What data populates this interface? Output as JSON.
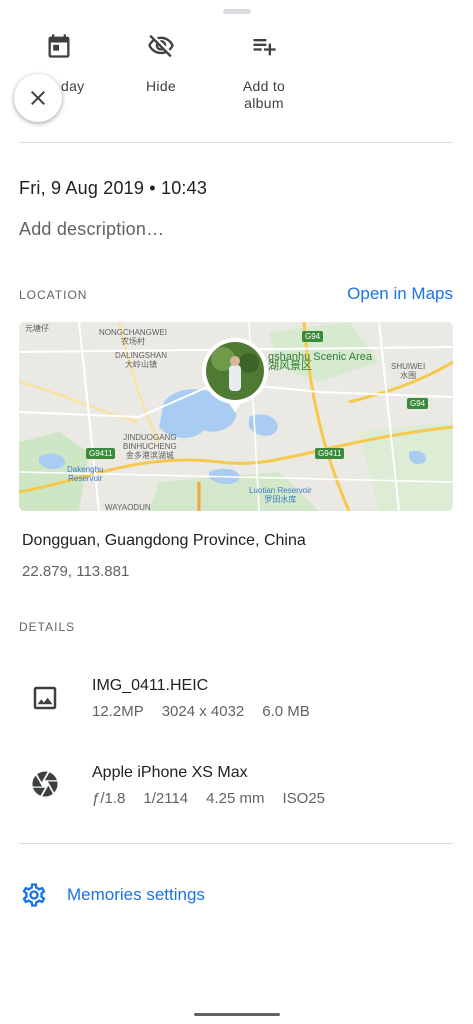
{
  "actions": {
    "day_label": "day",
    "hide_label": "Hide",
    "album_label_line1": "Add to",
    "album_label_line2": "album"
  },
  "info": {
    "datetime": "Fri, 9 Aug 2019  •  10:43",
    "description_placeholder": "Add description…"
  },
  "location": {
    "section_title": "LOCATION",
    "open_in_maps": "Open in Maps",
    "place": "Dongguan, Guangdong Province, China",
    "coordinates": "22.879, 113.881",
    "map_labels": {
      "nongchangwei": "NONGCHANGWEI",
      "nongchangwei_cn": "农场村",
      "dalingshan": "DALINGSHAN",
      "dalingshan_cn": "大岭山镇",
      "yuantang": "元塘仔",
      "scenic": "gshanhu Scenic Area",
      "scenic_cn": "湖风景区",
      "shuiwei": "SHUIWEI",
      "shuiwei_cn": "水围",
      "jinduogang": "JINDUOGANG",
      "binhucheng": "BINHUCHENG",
      "jinduogang_cn": "金多港滨湖城",
      "dakenghu": "Dakenghu",
      "reservoir": "Reservoir",
      "luotian": "Luotian Reservoir",
      "luotian_cn": "罗田水库",
      "wayaodun": "WAYAODUN",
      "g94_a": "G94",
      "g94_b": "G94",
      "g9411_a": "G9411",
      "g9411_b": "G9411"
    }
  },
  "details": {
    "section_title": "DETAILS",
    "file": {
      "name": "IMG_0411.HEIC",
      "megapixels": "12.2MP",
      "resolution": "3024 x 4032",
      "size": "6.0 MB"
    },
    "camera": {
      "model": "Apple iPhone XS Max",
      "aperture": "ƒ/1.8",
      "shutter": "1/2114",
      "focal_length": "4.25 mm",
      "iso": "ISO25"
    }
  },
  "memories": {
    "label": "Memories settings"
  },
  "colors": {
    "accent": "#1a73e8",
    "text_primary": "#202124",
    "text_secondary": "#5f6368",
    "divider": "#dadce0"
  }
}
